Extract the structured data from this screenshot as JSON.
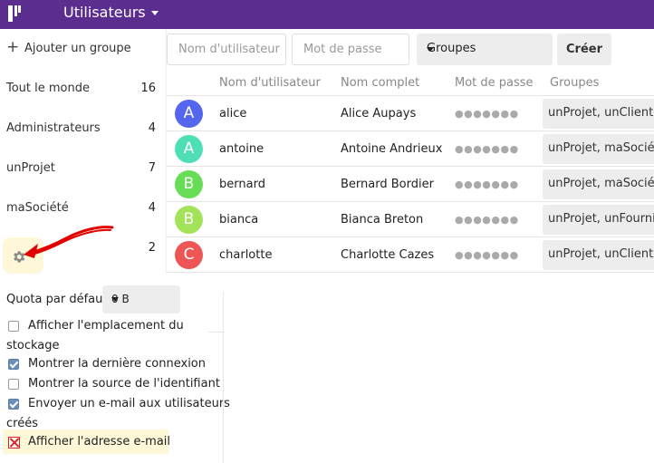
{
  "header": {
    "title": "Utilisateurs"
  },
  "sidebar": {
    "add_group_label": "Ajouter un groupe",
    "groups": [
      {
        "label": "Tout le monde",
        "count": "16"
      },
      {
        "label": "Administrateurs",
        "count": "4"
      },
      {
        "label": "unProjet",
        "count": "7"
      },
      {
        "label": "maSociété",
        "count": "4"
      }
    ],
    "extra_count": "2"
  },
  "settings": {
    "quota_label": "Quota par défaut",
    "quota_value": "0 B",
    "options": [
      {
        "line1": "Afficher l'emplacement du",
        "line2": "stockage",
        "checked": false
      },
      {
        "line1": "Montrer la dernière connexion",
        "checked": true
      },
      {
        "line1": "Montrer la source de l'identifiant",
        "checked": false
      },
      {
        "line1": "Envoyer un e-mail aux utilisateurs",
        "line2": "créés",
        "checked": true
      },
      {
        "line1": "Afficher l'adresse e-mail",
        "checked": false
      }
    ]
  },
  "new_user": {
    "username_placeholder": "Nom d'utilisateur",
    "password_placeholder": "Mot de passe",
    "groups_label": "Groupes",
    "create_label": "Créer"
  },
  "table": {
    "headers": [
      "Nom d'utilisateur",
      "Nom complet",
      "Mot de passe",
      "Groupes"
    ],
    "rows": [
      {
        "initial": "A",
        "color": "#5566ee",
        "username": "alice",
        "fullname": "Alice Aupays",
        "password": "●●●●●●●",
        "groups": "unProjet, unClient"
      },
      {
        "initial": "A",
        "color": "#4fdfb6",
        "username": "antoine",
        "fullname": "Antoine Andrieux",
        "password": "●●●●●●●",
        "groups": "unProjet, maSociété"
      },
      {
        "initial": "B",
        "color": "#66dd55",
        "username": "bernard",
        "fullname": "Bernard Bordier",
        "password": "●●●●●●●",
        "groups": "unProjet, maSociété"
      },
      {
        "initial": "B",
        "color": "#a3e35a",
        "username": "bianca",
        "fullname": "Bianca Breton",
        "password": "●●●●●●●",
        "groups": "unProjet, unFournisseur"
      },
      {
        "initial": "C",
        "color": "#ee5555",
        "username": "charlotte",
        "fullname": "Charlotte Cazes",
        "password": "●●●●●●●",
        "groups": "unProjet, unClient"
      }
    ]
  },
  "colors": {
    "header_bg": "#5b2d8e",
    "annotation": "#e00000",
    "highlight": "#fff8d8"
  }
}
